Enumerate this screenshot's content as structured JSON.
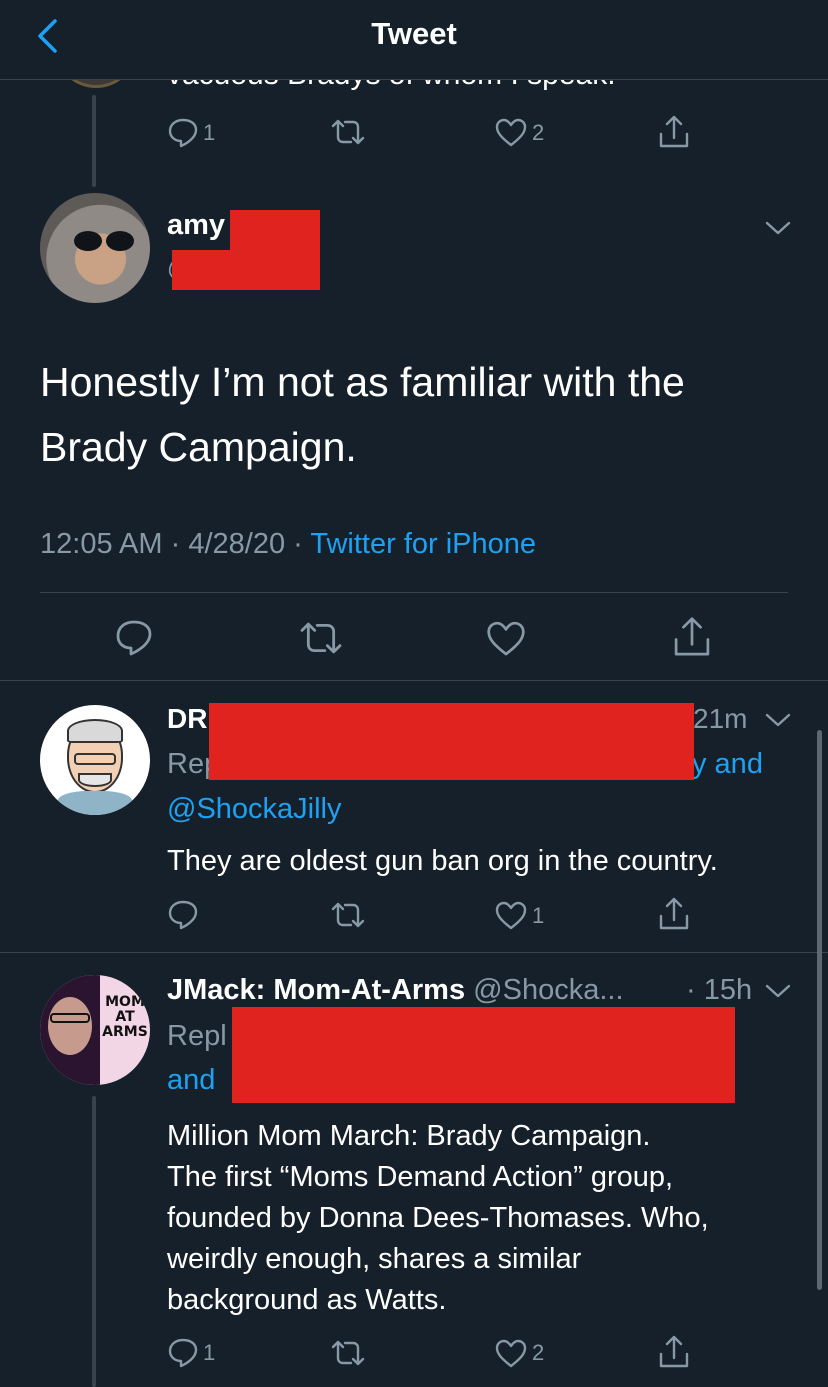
{
  "header": {
    "title": "Tweet"
  },
  "prev_tweet": {
    "text_clipped": "vacuous Bradys of whom I speak.",
    "reply_count": "1",
    "like_count": "2"
  },
  "main_tweet": {
    "name": "amy",
    "handle": "@",
    "text_line1": "Honestly I’m not as familiar with the",
    "text_line2": "Brady Campaign.",
    "time": "12:05 AM",
    "sep1": "·",
    "date": "4/28/20",
    "sep2": "·",
    "source": "Twitter for iPhone"
  },
  "reply1": {
    "name": "DR",
    "time": "21m",
    "replying_prefix": "Rep",
    "replying_suffix": "y and",
    "mention": "@ShockaJilly",
    "text": "They are oldest gun ban org in the country.",
    "like_count": "1"
  },
  "reply2": {
    "name": "JMack: Mom-At-Arms",
    "handle": "@Shocka...",
    "time": "· 15h",
    "replying_prefix": "Repl",
    "replying_and": "and",
    "avatar_badge": [
      "MOM",
      "AT",
      "ARMS"
    ],
    "text_lines": [
      "Million Mom March: Brady Campaign.",
      "The first “Moms Demand Action” group,",
      "founded by Donna Dees-Thomases. Who,",
      "weirdly enough, shares a similar",
      "background as Watts."
    ],
    "reply_count": "1",
    "like_count": "2"
  },
  "colors": {
    "background": "#15202b",
    "accent": "#1da1f2",
    "muted": "#8899a6",
    "divider": "#38444d",
    "redaction": "#e0231f"
  }
}
